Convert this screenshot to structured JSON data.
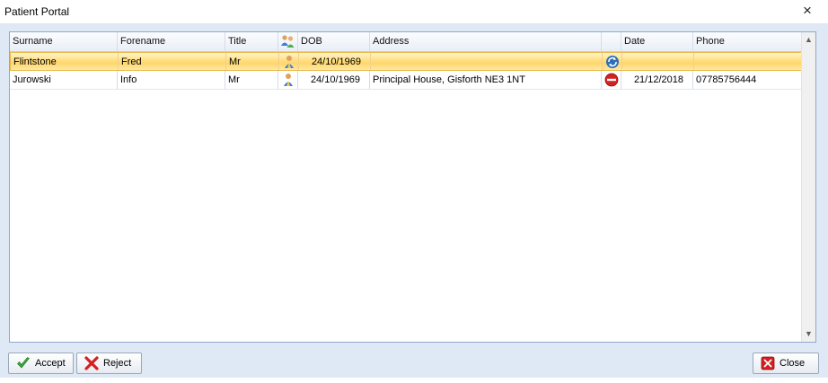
{
  "window": {
    "title": "Patient Portal",
    "close_glyph": "×"
  },
  "columns": [
    {
      "key": "surname",
      "label": "Surname"
    },
    {
      "key": "forename",
      "label": "Forename"
    },
    {
      "key": "title",
      "label": "Title"
    },
    {
      "key": "type",
      "label": "",
      "icon": "users-icon"
    },
    {
      "key": "dob",
      "label": "DOB"
    },
    {
      "key": "address",
      "label": "Address"
    },
    {
      "key": "status",
      "label": ""
    },
    {
      "key": "date",
      "label": "Date"
    },
    {
      "key": "phone",
      "label": "Phone"
    }
  ],
  "rows": [
    {
      "surname": "Flintstone",
      "forename": "Fred",
      "title": "Mr",
      "type_icon": "person-icon",
      "dob": "24/10/1969",
      "address": "",
      "status_icon": "refresh-icon",
      "date": "",
      "phone": "",
      "selected": true
    },
    {
      "surname": "Jurowski",
      "forename": "Info",
      "title": "Mr",
      "type_icon": "person-icon",
      "dob": "24/10/1969",
      "address": "Principal House, Gisforth  NE3 1NT",
      "status_icon": "stop-icon",
      "date": "21/12/2018",
      "phone": "07785756444",
      "selected": false
    }
  ],
  "buttons": {
    "accept": "Accept",
    "reject": "Reject",
    "close": "Close"
  },
  "colors": {
    "selected_row": "#ffd66a",
    "accept_icon": "#3aa83a",
    "reject_icon": "#d42020",
    "close_icon": "#d42020"
  }
}
